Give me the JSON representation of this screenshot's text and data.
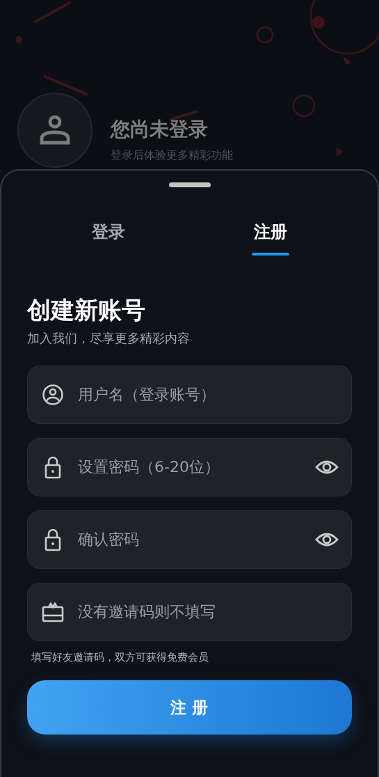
{
  "header": {
    "title": "您尚未登录",
    "subtitle": "登录后体验更多精彩功能"
  },
  "tabs": [
    {
      "label": "登录",
      "selected": false
    },
    {
      "label": "注册",
      "selected": true
    }
  ],
  "form": {
    "title": "创建新账号",
    "subtitle": "加入我们，尽享更多精彩内容",
    "fields": [
      {
        "kind": "user",
        "placeholder": "用户名（登录账号）",
        "reveal": false
      },
      {
        "kind": "password",
        "placeholder": "设置密码（6-20位）",
        "reveal": true
      },
      {
        "kind": "password",
        "placeholder": "确认密码",
        "reveal": true
      },
      {
        "kind": "gift",
        "placeholder": "没有邀请码则不填写",
        "reveal": false
      }
    ],
    "hint": "填写好友邀请码，双方可获得免费会员",
    "submit": "注 册"
  }
}
